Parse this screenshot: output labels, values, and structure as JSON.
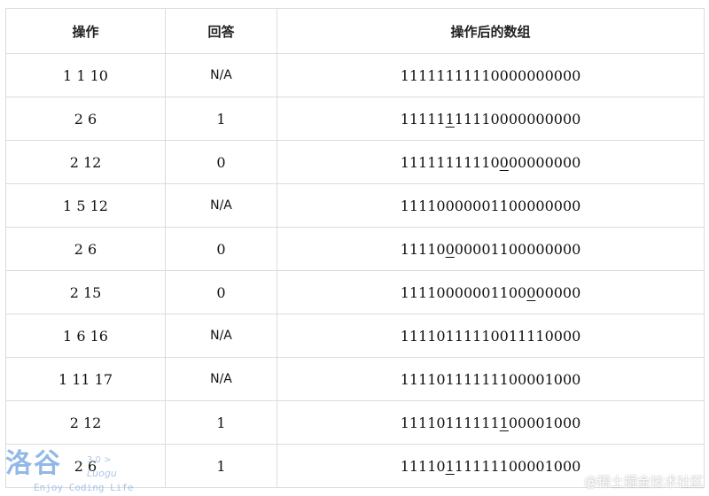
{
  "table": {
    "headers": [
      "操作",
      "回答",
      "操作后的数组"
    ],
    "rows": [
      {
        "op": "1 1 10",
        "answer": "N/A",
        "array": [
          "1111111111",
          "0000000000"
        ]
      },
      {
        "op": "2 6",
        "answer": "1",
        "array": [
          "11111",
          "1",
          "11110000000000"
        ]
      },
      {
        "op": "2 12",
        "answer": "0",
        "array": [
          "11111111110",
          "0",
          "00000000"
        ]
      },
      {
        "op": "1 5 12",
        "answer": "N/A",
        "array": [
          "11110000001100000000"
        ]
      },
      {
        "op": "2 6",
        "answer": "0",
        "array": [
          "11110",
          "0",
          "00001100000000"
        ]
      },
      {
        "op": "2 15",
        "answer": "0",
        "array": [
          "11110000001100",
          "0",
          "00000"
        ]
      },
      {
        "op": "1 6 16",
        "answer": "N/A",
        "array": [
          "11110111110011110000"
        ]
      },
      {
        "op": "1 11 17",
        "answer": "N/A",
        "array": [
          "11110111111100001000"
        ]
      },
      {
        "op": "2 12",
        "answer": "1",
        "array": [
          "11110111111",
          "1",
          "00001000"
        ]
      },
      {
        "op": "2 6",
        "answer": "1",
        "array": [
          "11110",
          "1",
          "11111100001000"
        ]
      }
    ]
  },
  "watermarks": {
    "luogu_glyphs": "洛谷",
    "luogu_version": "3.0 >",
    "luogu_name": "Luogu",
    "luogu_slogan": "Enjoy Coding Life",
    "juejin": "@稀土掘金技术社区"
  }
}
